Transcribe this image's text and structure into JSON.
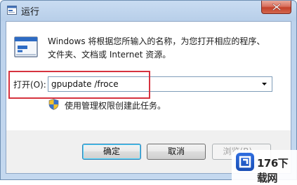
{
  "window": {
    "title": "运行",
    "close_icon": "close-icon"
  },
  "dialog": {
    "description": "Windows 将根据您所输入的名称，为您打开相应的程序、文件夹、文档或 Internet 资源。",
    "open_label": "打开(O):",
    "open_value": "gpupdate /froce",
    "admin_note": "使用管理权限创建此任务。"
  },
  "buttons": {
    "ok": "确定",
    "cancel": "取消",
    "browse": "浏览(B)..."
  },
  "watermark": {
    "text": "176下载网"
  },
  "colors": {
    "highlight_frame": "#d6333f",
    "title_gradient_top": "#c9dcf2",
    "close_button": "#c4412a"
  }
}
